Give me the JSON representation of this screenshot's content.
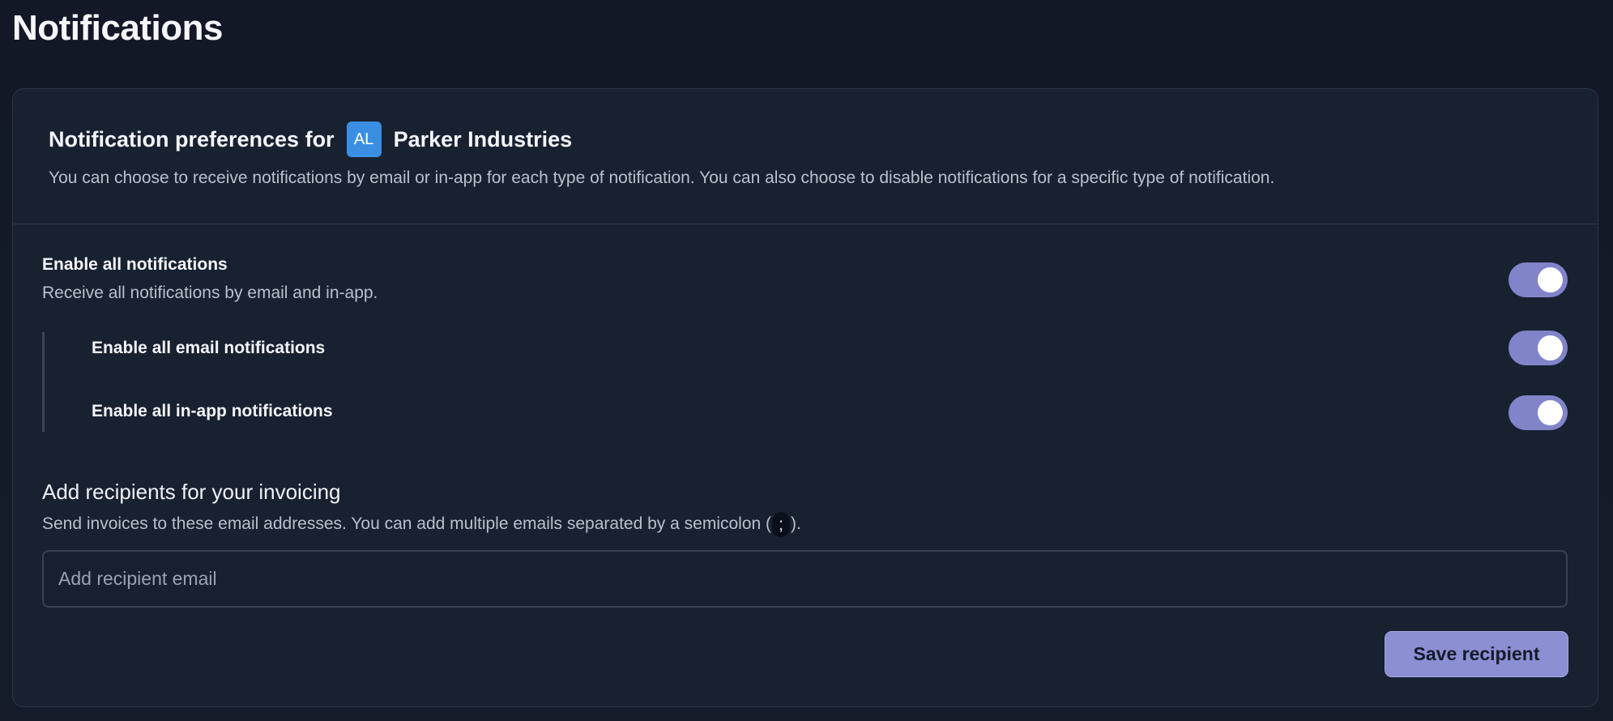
{
  "page": {
    "title": "Notifications"
  },
  "preferences": {
    "title_prefix": "Notification preferences for",
    "org_initials": "AL",
    "org_name": "Parker Industries",
    "description": "You can choose to receive notifications by email or in-app for each type of notification. You can also choose to disable notifications for a specific type of notification."
  },
  "settings": {
    "all": {
      "label": "Enable all notifications",
      "description": "Receive all notifications by email and in-app.",
      "enabled": true
    },
    "email": {
      "label": "Enable all email notifications",
      "enabled": true
    },
    "in_app": {
      "label": "Enable all in-app notifications",
      "enabled": true
    }
  },
  "invoicing": {
    "title": "Add recipients for your invoicing",
    "description_before": "Send invoices to these email addresses. You can add multiple emails separated by a semicolon (",
    "separator": ";",
    "description_after": ").",
    "input_placeholder": "Add recipient email",
    "input_value": "",
    "save_label": "Save recipient"
  },
  "colors": {
    "accent": "#8c8fd3",
    "toggle_on": "#8184c9",
    "avatar": "#3b8fe3",
    "background": "#121826",
    "card": "#182130"
  }
}
